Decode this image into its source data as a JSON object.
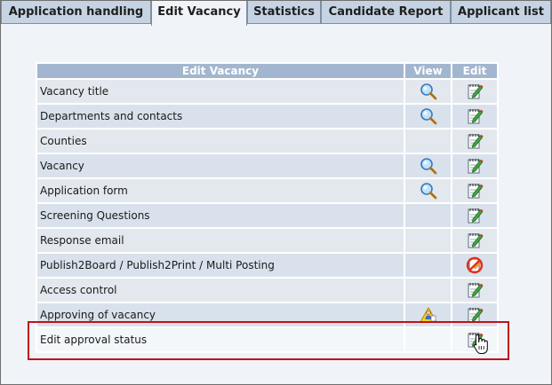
{
  "tabs": [
    {
      "label": "Application handling",
      "active": false
    },
    {
      "label": "Edit Vacancy",
      "active": true
    },
    {
      "label": "Statistics",
      "active": false
    },
    {
      "label": "Candidate Report",
      "active": false
    },
    {
      "label": "Applicant list",
      "active": false
    }
  ],
  "table": {
    "headers": {
      "name": "Edit Vacancy",
      "view": "View",
      "edit": "Edit"
    },
    "rows": [
      {
        "label": "Vacancy title",
        "view": "magnifier-icon",
        "edit": "notepad-edit-icon"
      },
      {
        "label": "Departments and contacts",
        "view": "magnifier-icon",
        "edit": "notepad-edit-icon"
      },
      {
        "label": "Counties",
        "view": "",
        "edit": "notepad-edit-icon"
      },
      {
        "label": "Vacancy",
        "view": "magnifier-icon",
        "edit": "notepad-edit-icon"
      },
      {
        "label": "Application form",
        "view": "magnifier-icon",
        "edit": "notepad-edit-icon"
      },
      {
        "label": "Screening Questions",
        "view": "",
        "edit": "notepad-edit-icon"
      },
      {
        "label": "Response email",
        "view": "",
        "edit": "notepad-edit-icon"
      },
      {
        "label": "Publish2Board / Publish2Print / Multi Posting",
        "view": "",
        "edit": "prohibited-icon"
      },
      {
        "label": "Access control",
        "view": "",
        "edit": "notepad-edit-icon"
      },
      {
        "label": "Approving of vacancy",
        "view": "warning-person-icon",
        "edit": "notepad-edit-icon"
      },
      {
        "label": "Edit approval status",
        "view": "",
        "edit": "notepad-edit-icon"
      }
    ]
  },
  "colors": {
    "header_bg": "#a3b6cf",
    "tab_bg": "#c5d3e3",
    "highlight_border": "#c0121b"
  }
}
